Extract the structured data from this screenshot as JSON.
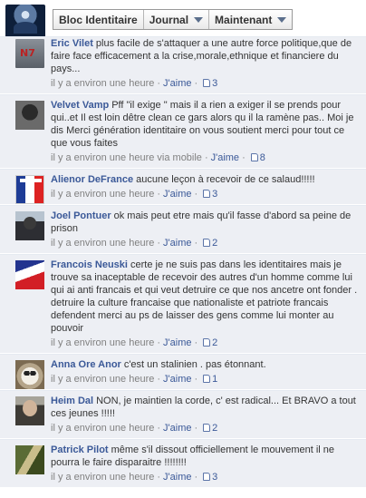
{
  "nav": {
    "items": [
      {
        "label": "Bloc Identitaire",
        "caret": false
      },
      {
        "label": "Journal",
        "caret": true
      },
      {
        "label": "Maintenant",
        "caret": true
      }
    ]
  },
  "comments": [
    {
      "author": "Eric Vilet",
      "text": "plus facile de s'attaquer a une autre force politique,que de faire face efficacement a la crise,morale,ethnique et financiere du pays...",
      "time": "il y a environ une heure",
      "like": "J'aime",
      "likes": "3",
      "avatar": "n7-icon"
    },
    {
      "author": "Velvet Vamp",
      "text": "Pff \"il exige \" mais il a rien a exiger il se prends pour qui..et Il est loin dêtre clean ce gars alors qu il la ramène pas.. Moi je dis Merci génération identitaire on vous soutient merci pour tout ce que vous faites",
      "time": "il y a environ une heure via mobile",
      "like": "J'aime",
      "likes": "8",
      "avatar": "vampire-icon"
    },
    {
      "author": "Alienor DeFrance",
      "text": "aucune leçon à recevoir de ce salaud!!!!!",
      "time": "il y a environ une heure",
      "like": "J'aime",
      "likes": "3",
      "avatar": "french-flag-icon"
    },
    {
      "author": "Joel Pontuer",
      "text": "ok mais peut etre mais qu'il fasse d'abord sa peine de prison",
      "time": "il y a environ une heure",
      "like": "J'aime",
      "likes": "2",
      "avatar": "soldier-icon"
    },
    {
      "author": "Francois Neuski",
      "text": "certe je ne suis pas dans les identitaires mais je trouve sa inaceptable de recevoir des autres d'un homme comme lui qui ai anti francais et qui veut detruire ce que nos ancetre ont fonder . detruire la culture francaise que nationaliste et patriote francais defendent merci au ps de laisser des gens comme lui monter au pouvoir",
      "time": "il y a environ une heure",
      "like": "J'aime",
      "likes": "2",
      "avatar": "waving-flag-icon"
    },
    {
      "author": "Anna Ore Anor",
      "text": "c'est un stalinien . pas étonnant.",
      "time": "il y a environ une heure",
      "like": "J'aime",
      "likes": "1",
      "avatar": "owl-icon"
    },
    {
      "author": "Heim Dal",
      "text": "NON, je maintien la corde, c' est radical... Et BRAVO a tout ces jeunes !!!!!",
      "time": "il y a environ une heure",
      "like": "J'aime",
      "likes": "2",
      "avatar": "portrait-icon"
    },
    {
      "author": "Patrick Pilot",
      "text": "même s'il dissout officiellement le mouvement il ne pourra le faire disparaitre !!!!!!!!",
      "time": "il y a environ une heure",
      "like": "J'aime",
      "likes": "3",
      "avatar": "camouflage-icon"
    }
  ],
  "colors": {
    "link": "#3b5998",
    "row_bg": "#edeff4",
    "meta": "#808080"
  }
}
